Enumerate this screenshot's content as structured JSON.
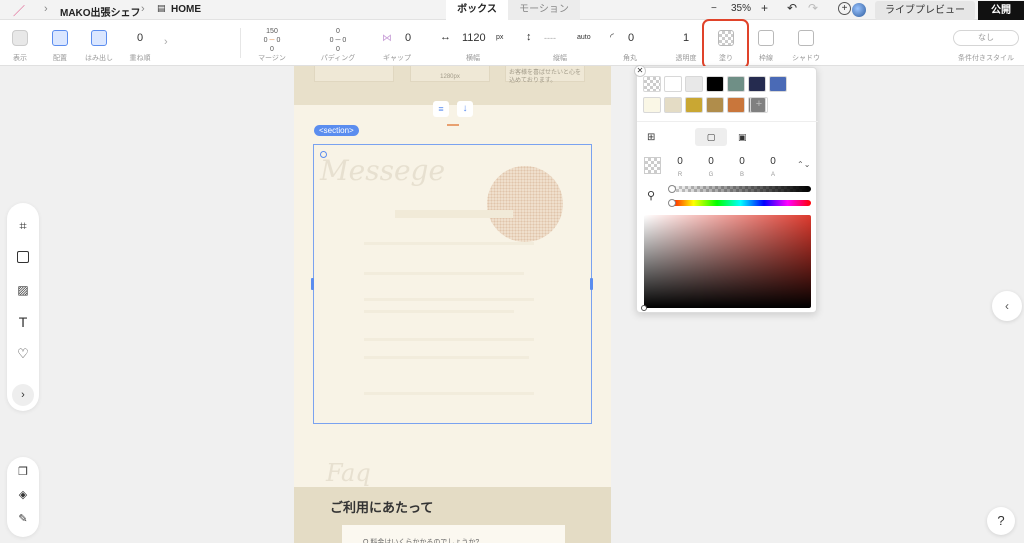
{
  "topbar": {
    "breadcrumb": {
      "project": "MAKO出張シェフ",
      "page": "HOME"
    },
    "tabs": [
      {
        "label": "ボックス",
        "active": true
      },
      {
        "label": "モーション",
        "active": false
      }
    ],
    "zoom": {
      "minus": "−",
      "value": "35%",
      "plus": "+"
    },
    "live_preview": "ライブプレビュー",
    "publish": "公開"
  },
  "toolbar": {
    "display": {
      "label": "表示"
    },
    "placement": {
      "label": "配置"
    },
    "overflow": {
      "label": "はみ出し"
    },
    "zorder": {
      "value": "0",
      "label": "重ね順"
    },
    "margin": {
      "top": "150",
      "left": "0",
      "right": "0",
      "bottom": "0",
      "label": "マージン"
    },
    "padding": {
      "top": "0",
      "left": "0",
      "right": "0",
      "bottom": "0",
      "label": "パディング"
    },
    "gap": {
      "value": "0",
      "label": "ギャップ"
    },
    "width": {
      "value": "1120",
      "unit": "px",
      "label": "横幅"
    },
    "height": {
      "value": "----",
      "unit": "auto",
      "label": "縦幅"
    },
    "radius": {
      "value": "0",
      "label": "角丸"
    },
    "opacity": {
      "value": "1",
      "label": "透明度"
    },
    "fill": {
      "label": "塗り"
    },
    "border": {
      "label": "枠線"
    },
    "shadow": {
      "label": "シャドウ"
    },
    "conditional": {
      "value": "なし",
      "label": "条件付きスタイル"
    }
  },
  "canvas": {
    "section_tag": "<section>",
    "message_script": "Messege",
    "faq_script": "Faq",
    "card_right_text": "お客様を喜ばせたいと心を込めております。",
    "card_mid_text": "1280px",
    "heading": "ご利用にあたって",
    "faq_question": "Q.料金はいくらかかるのでしょうか?"
  },
  "color_picker": {
    "swatches": [
      "transparent",
      "#ffffff",
      "#e8e8e8",
      "#000000",
      "#6f8f86",
      "#252b4f",
      "#4a6ab6",
      "#faf7e6",
      "#e4dcc5",
      "#c9a733",
      "#b08d4b",
      "#c9763b",
      "#808080"
    ],
    "channels": [
      {
        "label": "R",
        "value": "0"
      },
      {
        "label": "G",
        "value": "0"
      },
      {
        "label": "B",
        "value": "0"
      },
      {
        "label": "A",
        "value": "0"
      }
    ]
  },
  "help": "?",
  "colors": {
    "accent": "#5b8def",
    "highlight": "#e0432a",
    "page_bg": "#f8f3e6",
    "band_bg": "#e4dcc5"
  }
}
